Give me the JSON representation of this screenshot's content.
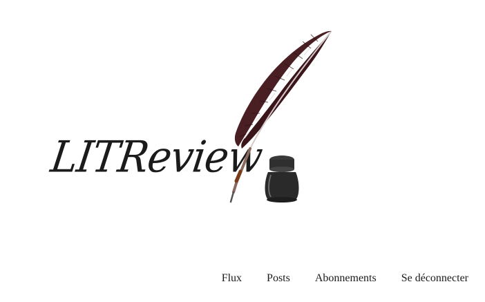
{
  "logo": {
    "text": "LITReview",
    "quill_icon": "quill-feather-icon",
    "inkwell_icon": "inkwell-icon"
  },
  "nav": {
    "items": [
      {
        "label": "Flux"
      },
      {
        "label": "Posts"
      },
      {
        "label": "Abonnements"
      },
      {
        "label": "Se déconnecter"
      }
    ]
  },
  "colors": {
    "background": "#ffffff",
    "text": "#1a1a1a",
    "feather": "#4a1f24",
    "ink": "#2a2a2a"
  }
}
